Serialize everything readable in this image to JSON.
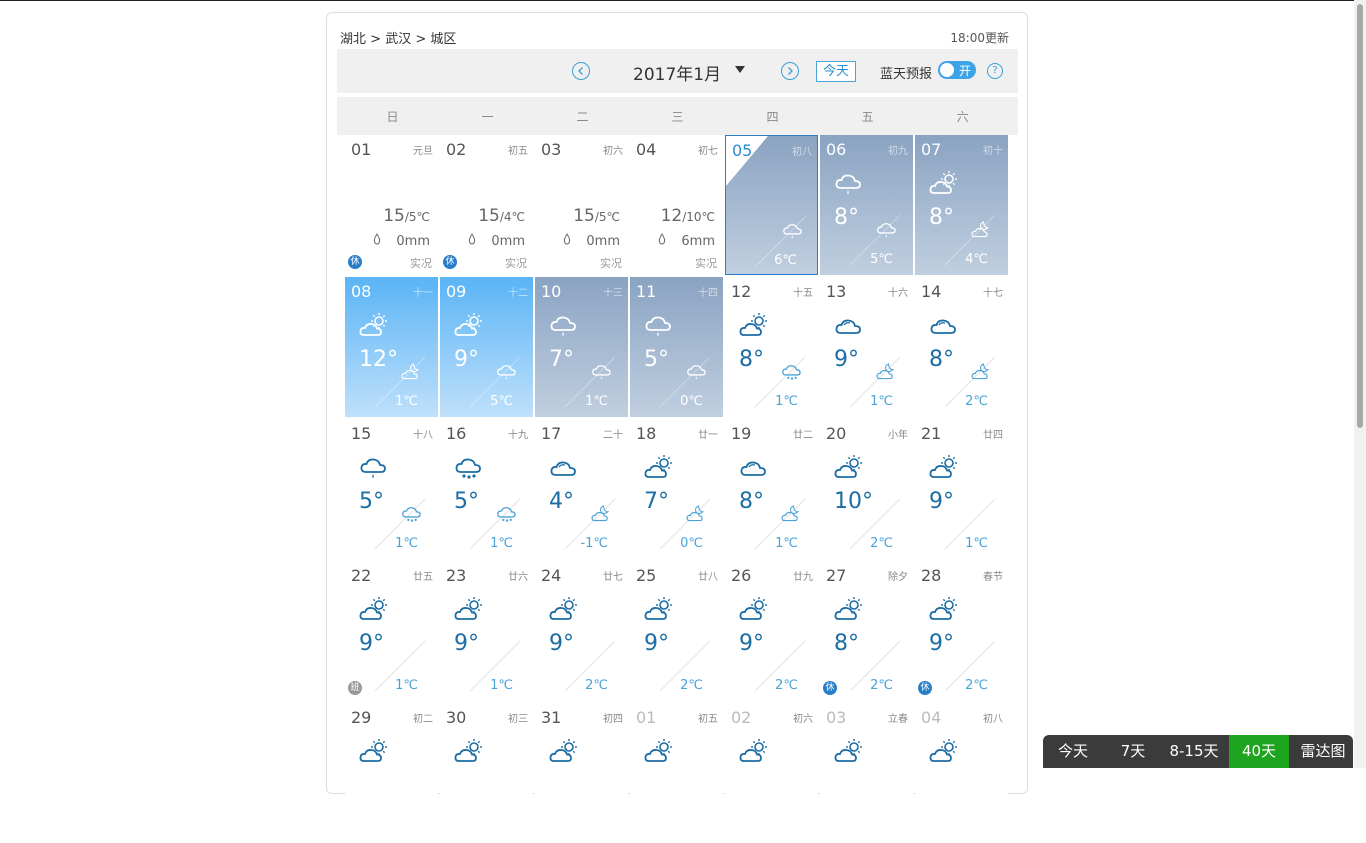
{
  "location": {
    "province": "湖北",
    "city": "武汉",
    "district": "城区",
    "sep": ">"
  },
  "update_time": "18:00更新",
  "toolbar": {
    "prev_icon": "chevron-left-icon",
    "month": "2017年1月",
    "next_icon": "chevron-right-icon",
    "today": "今天",
    "blue_sky": "蓝天预报",
    "toggle": "开",
    "help": "?"
  },
  "weekdays": [
    "日",
    "一",
    "二",
    "三",
    "四",
    "五",
    "六"
  ],
  "days": [
    {
      "date": "01",
      "lunar": "元旦",
      "kind": "past",
      "hi": "15",
      "lo": "5℃",
      "rain": "0mm",
      "src": "实况",
      "badge": "休"
    },
    {
      "date": "02",
      "lunar": "初五",
      "kind": "past",
      "hi": "15",
      "lo": "4℃",
      "rain": "0mm",
      "src": "实况",
      "badge": "休"
    },
    {
      "date": "03",
      "lunar": "初六",
      "kind": "past",
      "hi": "15",
      "lo": "5℃",
      "rain": "0mm",
      "src": "实况"
    },
    {
      "date": "04",
      "lunar": "初七",
      "kind": "past",
      "hi": "12",
      "lo": "10℃",
      "rain": "6mm",
      "src": "实况"
    },
    {
      "date": "05",
      "lunar": "初八",
      "kind": "gray",
      "sel": true,
      "icon": "",
      "lo": "6℃",
      "sicon": "rain"
    },
    {
      "date": "06",
      "lunar": "初九",
      "kind": "gray",
      "icon": "rain",
      "hi": "8°",
      "lo": "5℃",
      "sicon": "rain"
    },
    {
      "date": "07",
      "lunar": "初十",
      "kind": "gray",
      "icon": "sunny-cloud",
      "hi": "8°",
      "lo": "4℃",
      "sicon": "moon-cloud"
    },
    {
      "date": "08",
      "lunar": "十一",
      "kind": "bright",
      "icon": "sunny-cloud",
      "hi": "12°",
      "lo": "1℃",
      "sicon": "moon-cloud"
    },
    {
      "date": "09",
      "lunar": "十二",
      "kind": "bright",
      "icon": "sunny-cloud",
      "hi": "9°",
      "lo": "5℃",
      "sicon": "rain"
    },
    {
      "date": "10",
      "lunar": "十三",
      "kind": "gray",
      "icon": "rain",
      "hi": "7°",
      "lo": "1℃",
      "sicon": "rain"
    },
    {
      "date": "11",
      "lunar": "十四",
      "kind": "gray",
      "icon": "rain",
      "hi": "5°",
      "lo": "0℃",
      "sicon": "rain"
    },
    {
      "date": "12",
      "lunar": "十五",
      "kind": "fut",
      "icon": "sunny-cloud",
      "hi": "8°",
      "lo": "1℃",
      "sicon": "snow"
    },
    {
      "date": "13",
      "lunar": "十六",
      "kind": "fut",
      "icon": "cloud",
      "hi": "9°",
      "lo": "1℃",
      "sicon": "moon-cloud"
    },
    {
      "date": "14",
      "lunar": "十七",
      "kind": "fut",
      "icon": "cloud",
      "hi": "8°",
      "lo": "2℃",
      "sicon": "moon-cloud"
    },
    {
      "date": "15",
      "lunar": "十八",
      "kind": "fut",
      "icon": "rain",
      "hi": "5°",
      "lo": "1℃",
      "sicon": "snow"
    },
    {
      "date": "16",
      "lunar": "十九",
      "kind": "fut",
      "icon": "snow",
      "hi": "5°",
      "lo": "1℃",
      "sicon": "snow"
    },
    {
      "date": "17",
      "lunar": "二十",
      "kind": "fut",
      "icon": "cloud",
      "hi": "4°",
      "lo": "-1℃",
      "sicon": "moon-cloud"
    },
    {
      "date": "18",
      "lunar": "廿一",
      "kind": "fut",
      "icon": "sunny-cloud",
      "hi": "7°",
      "lo": "0℃",
      "sicon": "moon-cloud"
    },
    {
      "date": "19",
      "lunar": "廿二",
      "kind": "fut",
      "icon": "cloud",
      "hi": "8°",
      "lo": "1℃",
      "sicon": "moon-cloud"
    },
    {
      "date": "20",
      "lunar": "小年",
      "kind": "fut",
      "icon": "sunny-cloud",
      "hi": "10°",
      "lo": "2℃",
      "sicon": ""
    },
    {
      "date": "21",
      "lunar": "廿四",
      "kind": "fut",
      "icon": "sunny-cloud",
      "hi": "9°",
      "lo": "1℃",
      "sicon": ""
    },
    {
      "date": "22",
      "lunar": "廿五",
      "kind": "fut",
      "icon": "sunny-cloud",
      "hi": "9°",
      "lo": "1℃",
      "sicon": "",
      "badge": "班"
    },
    {
      "date": "23",
      "lunar": "廿六",
      "kind": "fut",
      "icon": "sunny-cloud",
      "hi": "9°",
      "lo": "1℃",
      "sicon": ""
    },
    {
      "date": "24",
      "lunar": "廿七",
      "kind": "fut",
      "icon": "sunny-cloud",
      "hi": "9°",
      "lo": "2℃",
      "sicon": ""
    },
    {
      "date": "25",
      "lunar": "廿八",
      "kind": "fut",
      "icon": "sunny-cloud",
      "hi": "9°",
      "lo": "2℃",
      "sicon": ""
    },
    {
      "date": "26",
      "lunar": "廿九",
      "kind": "fut",
      "icon": "sunny-cloud",
      "hi": "9°",
      "lo": "2℃",
      "sicon": ""
    },
    {
      "date": "27",
      "lunar": "除夕",
      "kind": "fut",
      "icon": "sunny-cloud",
      "hi": "8°",
      "lo": "2℃",
      "sicon": "",
      "badge": "休"
    },
    {
      "date": "28",
      "lunar": "春节",
      "kind": "fut",
      "icon": "sunny-cloud",
      "hi": "9°",
      "lo": "2℃",
      "sicon": "",
      "badge": "休"
    },
    {
      "date": "29",
      "lunar": "初二",
      "kind": "fut",
      "icon": "sunny-cloud"
    },
    {
      "date": "30",
      "lunar": "初三",
      "kind": "fut",
      "icon": "sunny-cloud"
    },
    {
      "date": "31",
      "lunar": "初四",
      "kind": "fut",
      "icon": "sunny-cloud"
    },
    {
      "date": "01",
      "lunar": "初五",
      "kind": "other",
      "icon": "sunny-cloud"
    },
    {
      "date": "02",
      "lunar": "初六",
      "kind": "other",
      "icon": "sunny-cloud"
    },
    {
      "date": "03",
      "lunar": "立春",
      "kind": "other",
      "icon": "sunny-cloud"
    },
    {
      "date": "04",
      "lunar": "初八",
      "kind": "other",
      "icon": "sunny-cloud"
    }
  ],
  "bottom_nav": [
    {
      "label": "今天",
      "active": false
    },
    {
      "label": "7天",
      "active": false
    },
    {
      "label": "8-15天",
      "active": false
    },
    {
      "label": "40天",
      "active": true
    },
    {
      "label": "雷达图",
      "active": false
    }
  ],
  "colors": {
    "accent": "#2a8fd0",
    "active_nav": "#1ea41e",
    "card_gray": "#8aa3c2",
    "card_blue": "#5ab4f5"
  }
}
